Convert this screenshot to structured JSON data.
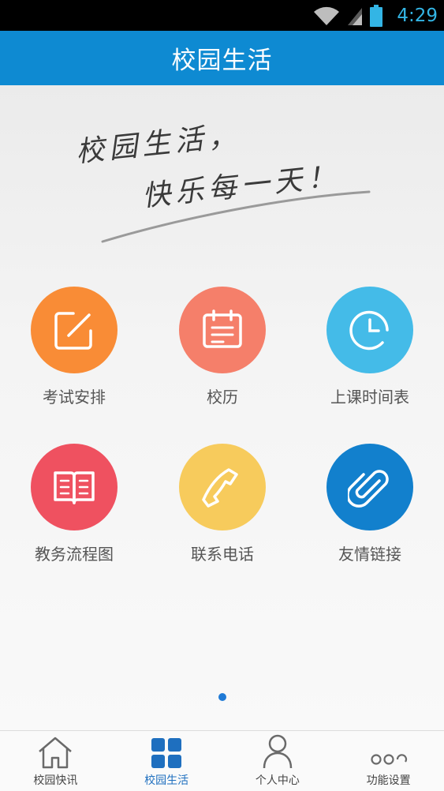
{
  "status_bar": {
    "time": "4:29",
    "icons": [
      "wifi-icon",
      "signal-icon",
      "battery-icon"
    ]
  },
  "header": {
    "title": "校园生活"
  },
  "banner": {
    "line1": "校园生活，",
    "line2": "快乐每一天！"
  },
  "grid": {
    "items": [
      {
        "label": "考试安排",
        "icon": "edit-icon",
        "color": "#f98c36"
      },
      {
        "label": "校历",
        "icon": "calendar-icon",
        "color": "#f57f6a"
      },
      {
        "label": "上课时间表",
        "icon": "clock-icon",
        "color": "#44bbe8"
      },
      {
        "label": "教务流程图",
        "icon": "book-icon",
        "color": "#ef5160"
      },
      {
        "label": "联系电话",
        "icon": "phone-icon",
        "color": "#f7cb5c"
      },
      {
        "label": "友情链接",
        "icon": "paperclip-icon",
        "color": "#1280cd"
      }
    ]
  },
  "pager": {
    "current_page": 1
  },
  "tabbar": {
    "tabs": [
      {
        "label": "校园快讯",
        "icon": "home-icon",
        "active": false
      },
      {
        "label": "校园生活",
        "icon": "grid-icon",
        "active": true
      },
      {
        "label": "个人中心",
        "icon": "person-icon",
        "active": false
      },
      {
        "label": "功能设置",
        "icon": "more-icon",
        "active": false
      }
    ]
  },
  "colors": {
    "header": "#0e8ad2",
    "accent": "#1f7ad6",
    "active_tab": "#1e6fbf"
  }
}
